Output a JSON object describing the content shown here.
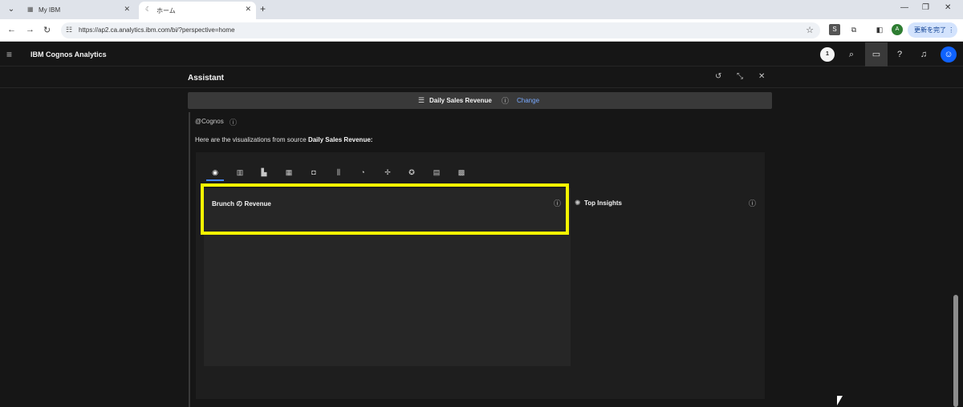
{
  "browser": {
    "tabs": [
      {
        "title": "My IBM",
        "favicon": "ibm-icon"
      },
      {
        "title": "ホーム",
        "favicon": "loading-icon"
      }
    ],
    "url": "https://ap2.ca.analytics.ibm.com/bi/?perspective=home",
    "update_button": "更新を完了 ⋮",
    "profile_initial": "A"
  },
  "app": {
    "name": "IBM Cognos Analytics",
    "badge": "1"
  },
  "assistant": {
    "title": "Assistant",
    "source": {
      "name": "Daily Sales Revenue",
      "change_label": "Change"
    },
    "message": {
      "author": "@Cognos",
      "intro": "Here are the visualizations from source ",
      "source_name": "Daily Sales Revenue:"
    },
    "visualization": {
      "tab_icons": [
        "map-icon",
        "bar-chart-icon",
        "column-chart-icon",
        "stacked-column-icon",
        "treemap-icon",
        "boxplot-icon",
        "pie-chart-icon",
        "network-icon",
        "radial-icon",
        "table-icon",
        "grid-icon"
      ],
      "chart_title": "Brunch の Revenue",
      "insights_title": "Top Insights"
    }
  }
}
